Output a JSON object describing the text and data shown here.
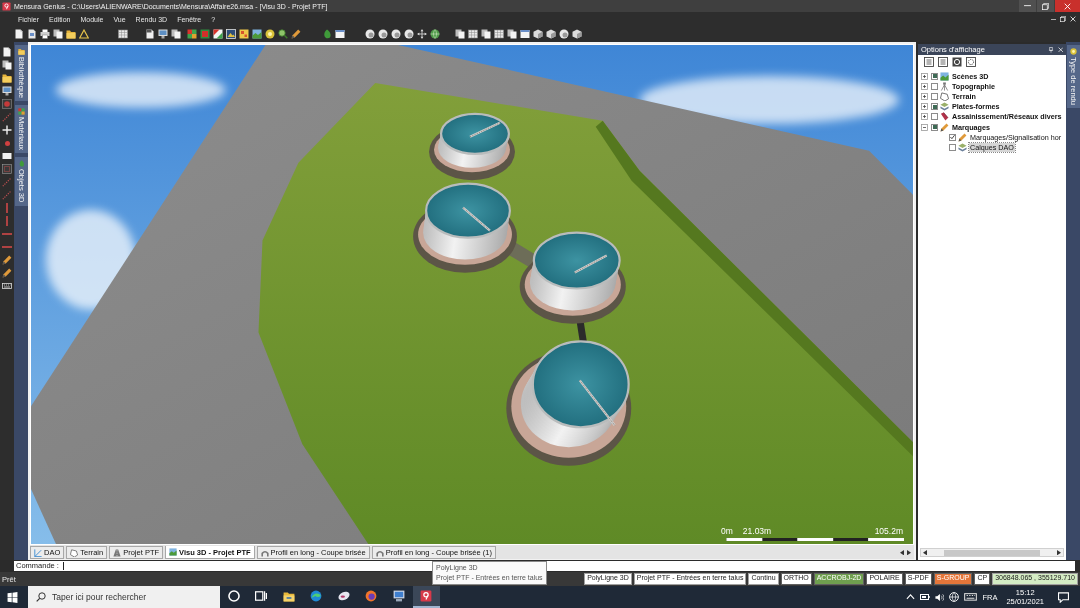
{
  "window": {
    "title": "Mensura Genius - C:\\Users\\ALIENWARE\\Documents\\Mensura\\Affaire26.msa - [Visu 3D - Projet PTF]"
  },
  "menu": [
    "Fichier",
    "Edition",
    "Module",
    "Vue",
    "Rendu 3D",
    "Fenêtre",
    "?"
  ],
  "left_tabs": [
    "Bibliothèque",
    "Matériaux",
    "Objets 3D"
  ],
  "viewport": {
    "scale_labels": [
      "0m",
      "21.03m",
      "105.2m"
    ]
  },
  "document_tabs": [
    {
      "label": "DAO",
      "selected": false
    },
    {
      "label": "Terrain",
      "selected": false
    },
    {
      "label": "Projet PTF",
      "selected": false
    },
    {
      "label": "Visu 3D - Projet PTF",
      "selected": true
    },
    {
      "label": "Profil en long - Coupe brisée",
      "selected": false
    },
    {
      "label": "Profil en long - Coupe brisée (1)",
      "selected": false
    }
  ],
  "display_options": {
    "title": "Options d'affichage",
    "tree": [
      {
        "label": "Scènes 3D",
        "expanded": false,
        "checked": true,
        "selected": false
      },
      {
        "label": "Topographie",
        "expanded": false,
        "checked": false,
        "selected": false
      },
      {
        "label": "Terrain",
        "expanded": false,
        "checked": false,
        "selected": false
      },
      {
        "label": "Plates-formes",
        "expanded": false,
        "checked": true,
        "selected": false
      },
      {
        "label": "Assainissement/Réseaux divers",
        "expanded": false,
        "checked": false,
        "selected": false
      },
      {
        "label": "Marquages",
        "expanded": true,
        "checked": true,
        "selected": false,
        "children": [
          {
            "label": "Marquages/Signalisation hor",
            "checked": true,
            "selected": false
          },
          {
            "label": "Calques DAO",
            "checked": false,
            "selected": true
          }
        ]
      }
    ]
  },
  "right_tabs": [
    "Type de rendu"
  ],
  "command_line": {
    "label": "Commande :"
  },
  "tooltip": {
    "lines": [
      "PolyLigne 3D",
      "Projet PTF - Entrées en terre talus"
    ]
  },
  "status_bar": {
    "message": "Prêt",
    "cells": [
      {
        "text": "PolyLigne 3D",
        "kind": "info",
        "color": "#ffffff"
      },
      {
        "text": "Projet PTF - Entrées en terre talus",
        "kind": "info",
        "color": "#ffffff"
      },
      {
        "text": "Continu",
        "kind": "info",
        "color": "#ffffff"
      },
      {
        "text": "ORTHO",
        "kind": "toggle",
        "color": "#ffffff"
      },
      {
        "text": "ACCROBJ-2D",
        "kind": "toggle",
        "color": "#6f9f4f"
      },
      {
        "text": "POLAIRE",
        "kind": "toggle",
        "color": "#ffffff"
      },
      {
        "text": "S-PDF",
        "kind": "toggle",
        "color": "#ffffff"
      },
      {
        "text": "S-GROUP",
        "kind": "toggle",
        "color": "#e5763a"
      },
      {
        "text": "CP",
        "kind": "toggle",
        "color": "#ffffff"
      },
      {
        "text": "306848.065 , 355129.710",
        "kind": "info",
        "color": "#d4ecc4"
      }
    ]
  },
  "taskbar": {
    "search": {
      "placeholder": "Taper ici pour rechercher"
    },
    "language": "FRA",
    "time": "15:12",
    "date": "25/01/2021"
  }
}
